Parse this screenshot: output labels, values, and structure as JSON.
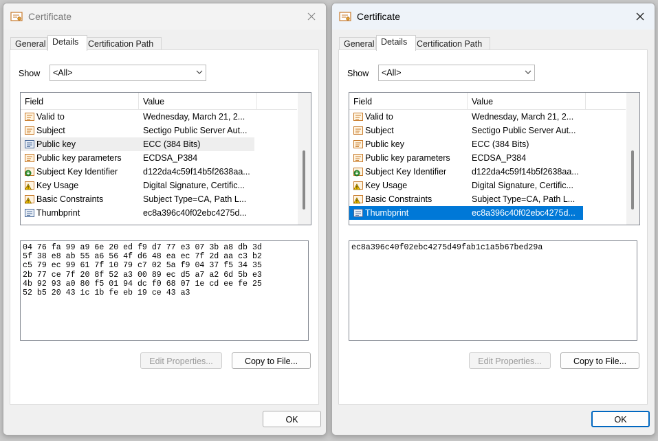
{
  "windows": [
    {
      "title": "Certificate",
      "tabs": [
        "General",
        "Details",
        "Certification Path"
      ],
      "active_tab": "Details",
      "show_label": "Show",
      "show_value": "<All>",
      "columns": {
        "field": "Field",
        "value": "Value"
      },
      "rows": [
        {
          "field": "Valid to",
          "value": "Wednesday, March 21, 2...",
          "icon": "certificate-field-icon"
        },
        {
          "field": "Subject",
          "value": "Sectigo Public Server Aut...",
          "icon": "certificate-field-icon"
        },
        {
          "field": "Public key",
          "value": "ECC (384 Bits)",
          "icon": "public-key-icon"
        },
        {
          "field": "Public key parameters",
          "value": "ECDSA_P384",
          "icon": "certificate-field-icon"
        },
        {
          "field": "Subject Key Identifier",
          "value": "d122da4c59f14b5f2638aa...",
          "icon": "extension-icon"
        },
        {
          "field": "Key Usage",
          "value": "Digital Signature, Certific...",
          "icon": "critical-extension-icon"
        },
        {
          "field": "Basic Constraints",
          "value": "Subject Type=CA, Path L...",
          "icon": "critical-extension-icon"
        },
        {
          "field": "Thumbprint",
          "value": "ec8a396c40f02ebc4275d...",
          "icon": "public-key-icon"
        }
      ],
      "selected_field": "Public key",
      "detail_text": "04 76 fa 99 a9 6e 20 ed f9 d7 77 e3 07 3b a8 db 3d\n5f 38 e8 ab 55 a6 56 4f d6 48 ea ec 7f 2d aa c3 b2\nc5 79 ec 99 61 7f 10 79 c7 02 5a f9 04 37 f5 34 35\n2b 77 ce 7f 20 8f 52 a3 00 89 ec d5 a7 a2 6d 5b e3\n4b 92 93 a0 80 f5 01 94 dc f0 68 07 1e cd ee fe 25\n52 b5 20 43 1c 1b fe eb 19 ce 43 a3",
      "edit_properties_label": "Edit Properties...",
      "copy_to_file_label": "Copy to File...",
      "ok_label": "OK"
    },
    {
      "title": "Certificate",
      "tabs": [
        "General",
        "Details",
        "Certification Path"
      ],
      "active_tab": "Details",
      "show_label": "Show",
      "show_value": "<All>",
      "columns": {
        "field": "Field",
        "value": "Value"
      },
      "rows": [
        {
          "field": "Valid to",
          "value": "Wednesday, March 21, 2...",
          "icon": "certificate-field-icon"
        },
        {
          "field": "Subject",
          "value": "Sectigo Public Server Aut...",
          "icon": "certificate-field-icon"
        },
        {
          "field": "Public key",
          "value": "ECC (384 Bits)",
          "icon": "certificate-field-icon"
        },
        {
          "field": "Public key parameters",
          "value": "ECDSA_P384",
          "icon": "certificate-field-icon"
        },
        {
          "field": "Subject Key Identifier",
          "value": "d122da4c59f14b5f2638aa...",
          "icon": "extension-icon"
        },
        {
          "field": "Key Usage",
          "value": "Digital Signature, Certific...",
          "icon": "critical-extension-icon"
        },
        {
          "field": "Basic Constraints",
          "value": "Subject Type=CA, Path L...",
          "icon": "critical-extension-icon"
        },
        {
          "field": "Thumbprint",
          "value": "ec8a396c40f02ebc4275d...",
          "icon": "public-key-icon"
        }
      ],
      "selected_field": "Thumbprint",
      "detail_text": "ec8a396c40f02ebc4275d49fab1c1a5b67bed29a",
      "edit_properties_label": "Edit Properties...",
      "copy_to_file_label": "Copy to File...",
      "ok_label": "OK"
    }
  ],
  "colors": {
    "selection_blue": "#0078d7",
    "selection_inactive": "#eeeeee",
    "default_button_border": "#0067c0",
    "certificate_icon": "#c87a2a"
  }
}
